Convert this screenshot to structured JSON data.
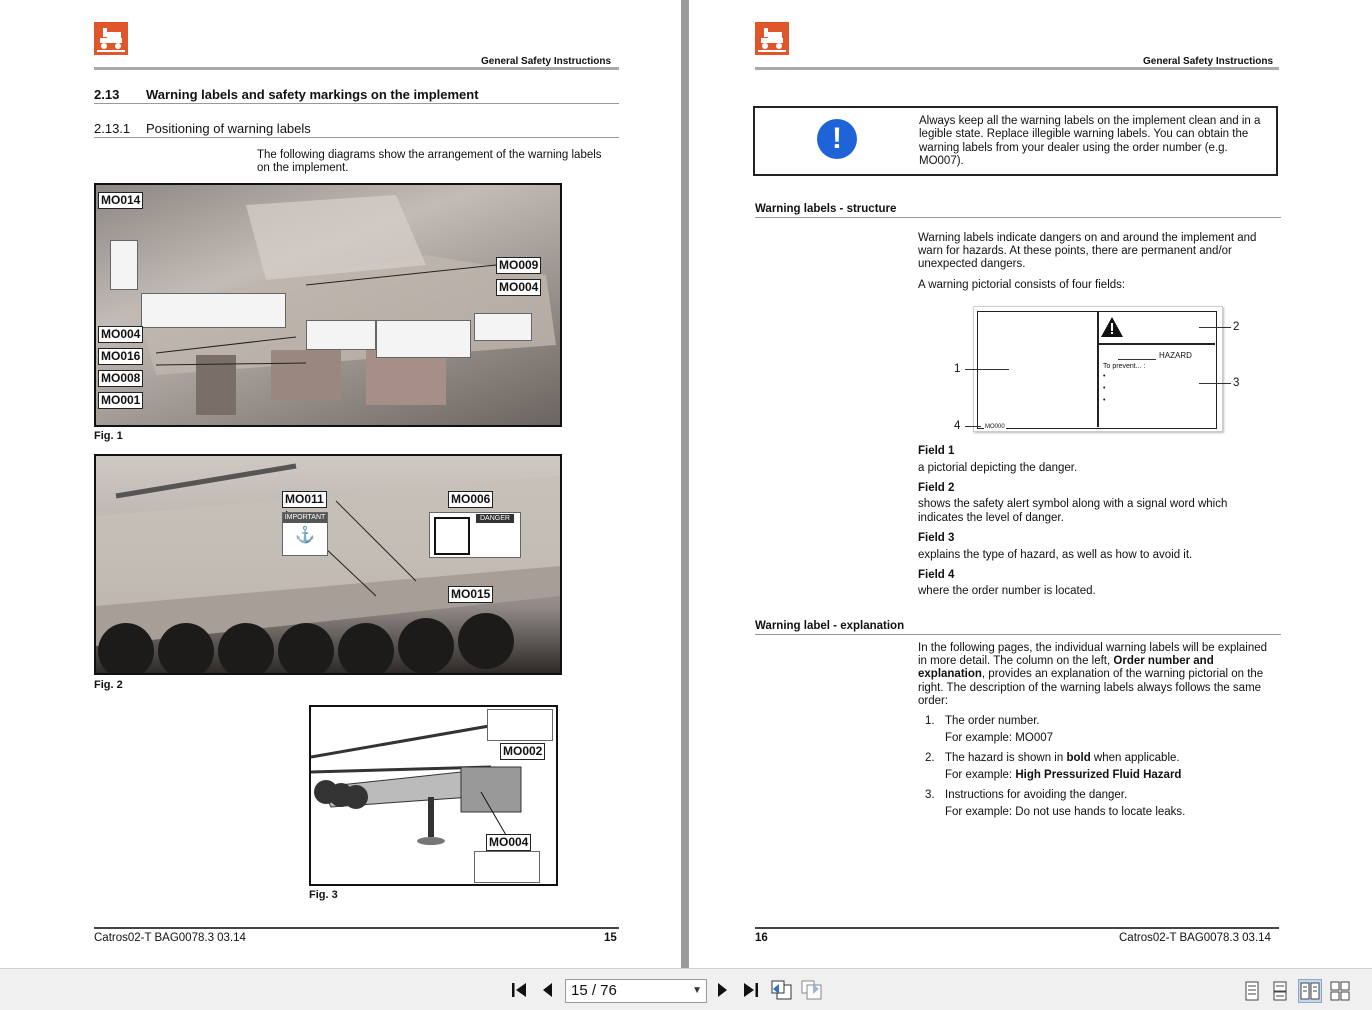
{
  "header": {
    "title": "General Safety Instructions"
  },
  "left_page": {
    "section": {
      "number": "2.13",
      "title": "Warning labels and safety markings on the implement"
    },
    "subsection": {
      "number": "2.13.1",
      "title": "Positioning of warning labels"
    },
    "intro_line1": "The following diagrams show the arrangement of the warning labels",
    "intro_line2": "on the implement.",
    "fig1": {
      "caption": "Fig. 1",
      "labels": [
        "MO014",
        "MO009",
        "MO004",
        "MO004",
        "MO016",
        "MO008",
        "MO001"
      ]
    },
    "fig2": {
      "caption": "Fig. 2",
      "labels": [
        "MO011",
        "MO006",
        "MO015"
      ],
      "sticker_important": "IMPORTANT",
      "sticker_danger": "DANGER"
    },
    "fig3": {
      "caption": "Fig. 3",
      "labels": [
        "MO002",
        "MO004"
      ]
    },
    "footer": {
      "doc": "Catros02-T  BAG0078.3  03.14",
      "page": "15"
    }
  },
  "right_page": {
    "notice": {
      "icon": "info-exclamation-icon",
      "lines": [
        "Always keep all the warning labels on the implement clean and in a",
        "legible state. Replace illegible warning labels. You can obtain the",
        "warning labels from your dealer using the order number (e.g.",
        "MO007)."
      ]
    },
    "structure": {
      "heading": "Warning labels - structure",
      "lines": [
        "Warning labels indicate dangers on and around the implement and",
        "warn for hazards. At these points, there are permanent and/or",
        "unexpected dangers."
      ],
      "four_fields": "A warning pictorial consists of four fields:",
      "diagram": {
        "hazard": "HAZARD",
        "prevent": "To prevent... :",
        "bullet": "•",
        "order": "MO000",
        "num1": "1",
        "num2": "2",
        "num3": "3",
        "num4": "4"
      },
      "fields": [
        {
          "title": "Field 1",
          "lines": [
            "a pictorial depicting the danger."
          ]
        },
        {
          "title": "Field 2",
          "lines": [
            "shows the safety alert symbol along with a signal word which",
            "indicates the level of danger."
          ]
        },
        {
          "title": "Field 3",
          "lines": [
            "explains the type of hazard, as well as how to avoid it."
          ]
        },
        {
          "title": "Field 4",
          "lines": [
            "where the order number is located."
          ]
        }
      ]
    },
    "explanation": {
      "heading": "Warning label - explanation",
      "line1": "In the following pages, the individual warning labels will be explained",
      "line2_a": "in more detail. The column on the left, ",
      "line2_b": "Order number and",
      "line3_a": "explanation",
      "line3_b": ", provides an explanation of the warning pictorial on the",
      "line4": "right. The description of the warning labels always follows the same",
      "line5": "order:",
      "items": [
        {
          "num": "1.",
          "text_a": "The order number.",
          "text_b": "",
          "text_c": "",
          "example_a": "For example: MO007",
          "example_b": ""
        },
        {
          "num": "2.",
          "text_a": "The hazard is shown in ",
          "text_b": "bold",
          "text_c": " when applicable.",
          "example_a": "For example: ",
          "example_b": "High Pressurized Fluid Hazard"
        },
        {
          "num": "3.",
          "text_a": "Instructions for avoiding the danger.",
          "text_b": "",
          "text_c": "",
          "example_a": "For example: Do not use hands to locate leaks.",
          "example_b": ""
        }
      ]
    },
    "footer": {
      "page": "16",
      "doc": "Catros02-T  BAG0078.3  03.14"
    }
  },
  "toolbar": {
    "page_display": "15 / 76",
    "icons": [
      "first-page-icon",
      "previous-page-icon",
      "next-page-icon",
      "last-page-icon",
      "previous-view-icon",
      "next-view-icon",
      "single-page-view-icon",
      "continuous-view-icon",
      "two-page-view-icon",
      "two-page-continuous-view-icon"
    ]
  },
  "colors": {
    "brand": "#e0562b",
    "info_blue": "#1f63d8",
    "toolbar": "#f0f0f0",
    "page_gap": "#9a9a9a"
  }
}
